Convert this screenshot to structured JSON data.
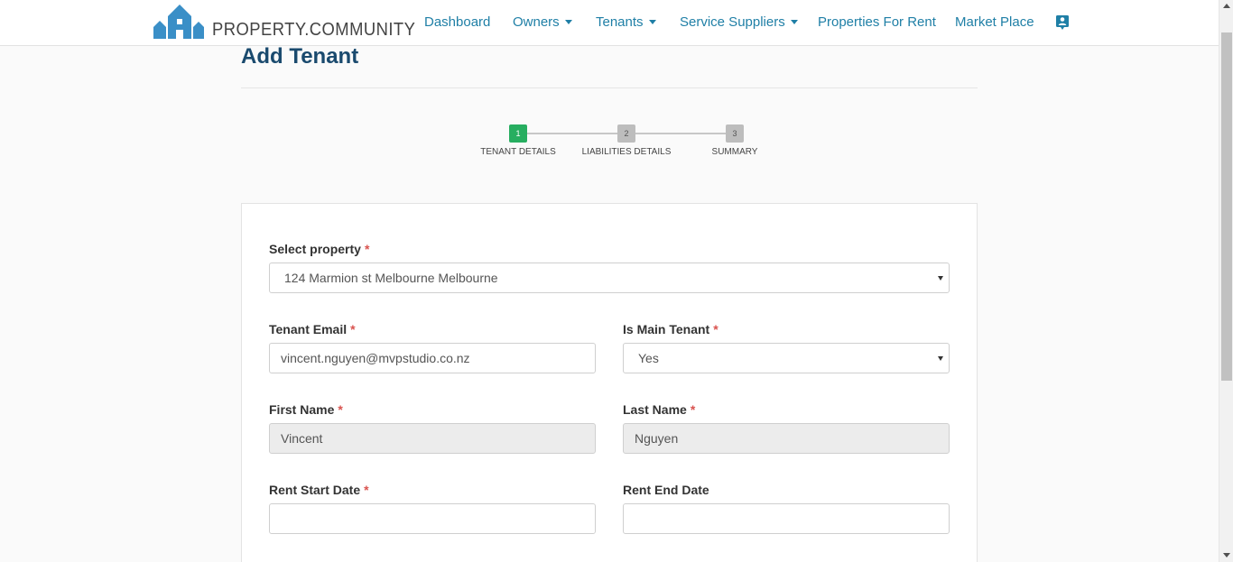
{
  "brand": {
    "name": "PROPERTY.COMMUNITY",
    "logo_icon": "house-logo-icon",
    "color": "#3a8fc7"
  },
  "nav": {
    "dashboard": "Dashboard",
    "owners": "Owners",
    "tenants": "Tenants",
    "service_suppliers": "Service Suppliers",
    "properties_for_rent": "Properties For Rent",
    "market_place": "Market Place",
    "contact_icon": "contact-card-icon"
  },
  "page": {
    "title": "Add Tenant"
  },
  "stepper": {
    "steps": [
      {
        "number": "1",
        "label": "TENANT DETAILS",
        "state": "active"
      },
      {
        "number": "2",
        "label": "LIABILITIES DETAILS",
        "state": "inactive"
      },
      {
        "number": "3",
        "label": "SUMMARY",
        "state": "inactive"
      }
    ],
    "active_color": "#27ae60"
  },
  "form": {
    "required_marker": "*",
    "select_property": {
      "label": "Select property",
      "value": "124 Marmion st Melbourne Melbourne"
    },
    "tenant_email": {
      "label": "Tenant Email",
      "value": "vincent.nguyen@mvpstudio.co.nz"
    },
    "is_main_tenant": {
      "label": "Is Main Tenant",
      "value": "Yes"
    },
    "first_name": {
      "label": "First Name",
      "value": "Vincent"
    },
    "last_name": {
      "label": "Last Name",
      "value": "Nguyen"
    },
    "rent_start_date": {
      "label": "Rent Start Date",
      "value": ""
    },
    "rent_end_date": {
      "label": "Rent End Date",
      "value": ""
    }
  }
}
